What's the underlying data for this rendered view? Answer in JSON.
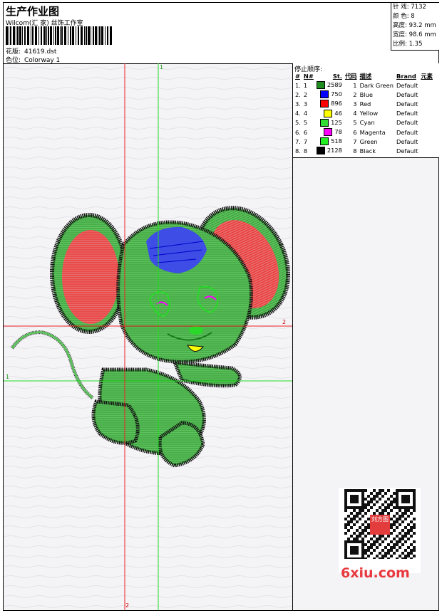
{
  "header": {
    "title": "生产作业图",
    "company": "Wilcom(汇 家) 丝饰工作室",
    "design_label": "花版:",
    "design_value": "41619.dst",
    "colorway_label": "色位:",
    "colorway_value": "Colorway 1"
  },
  "stats": {
    "stitches": "针 戏: 7132",
    "colors": "颜 色: 8",
    "height": "高度: 93.2 mm",
    "width": "宽度: 98.6 mm",
    "scale": "比例: 1.35"
  },
  "colorway_panel": {
    "title": "停止顺序:",
    "headers": [
      "#",
      "N#",
      "St.",
      "代码",
      "描述",
      "Brand",
      "元素"
    ],
    "rows": [
      {
        "idx": "1.",
        "n": "1",
        "color": "#1e8c1e",
        "st": "2589",
        "code": "1",
        "desc": "Dark Green",
        "brand": "Default"
      },
      {
        "idx": "2.",
        "n": "2",
        "color": "#0000ff",
        "st": "750",
        "code": "2",
        "desc": "Blue",
        "brand": "Default"
      },
      {
        "idx": "3.",
        "n": "3",
        "color": "#ff0000",
        "st": "896",
        "code": "3",
        "desc": "Red",
        "brand": "Default"
      },
      {
        "idx": "4.",
        "n": "4",
        "color": "#ffff00",
        "st": "46",
        "code": "4",
        "desc": "Yellow",
        "brand": "Default"
      },
      {
        "idx": "5.",
        "n": "5",
        "color": "#33dd33",
        "st": "125",
        "code": "5",
        "desc": "Cyan",
        "brand": "Default"
      },
      {
        "idx": "6.",
        "n": "6",
        "color": "#ff00ff",
        "st": "78",
        "code": "6",
        "desc": "Magenta",
        "brand": "Default"
      },
      {
        "idx": "7.",
        "n": "7",
        "color": "#22ee22",
        "st": "518",
        "code": "7",
        "desc": "Green",
        "brand": "Default"
      },
      {
        "idx": "8.",
        "n": "8",
        "color": "#000000",
        "st": "2128",
        "code": "8",
        "desc": "Black",
        "brand": "Default"
      }
    ]
  },
  "guides": {
    "green_label": "1",
    "red_label": "2"
  },
  "watermark": {
    "text": "6xiu.com",
    "stamp": "刘方图"
  }
}
